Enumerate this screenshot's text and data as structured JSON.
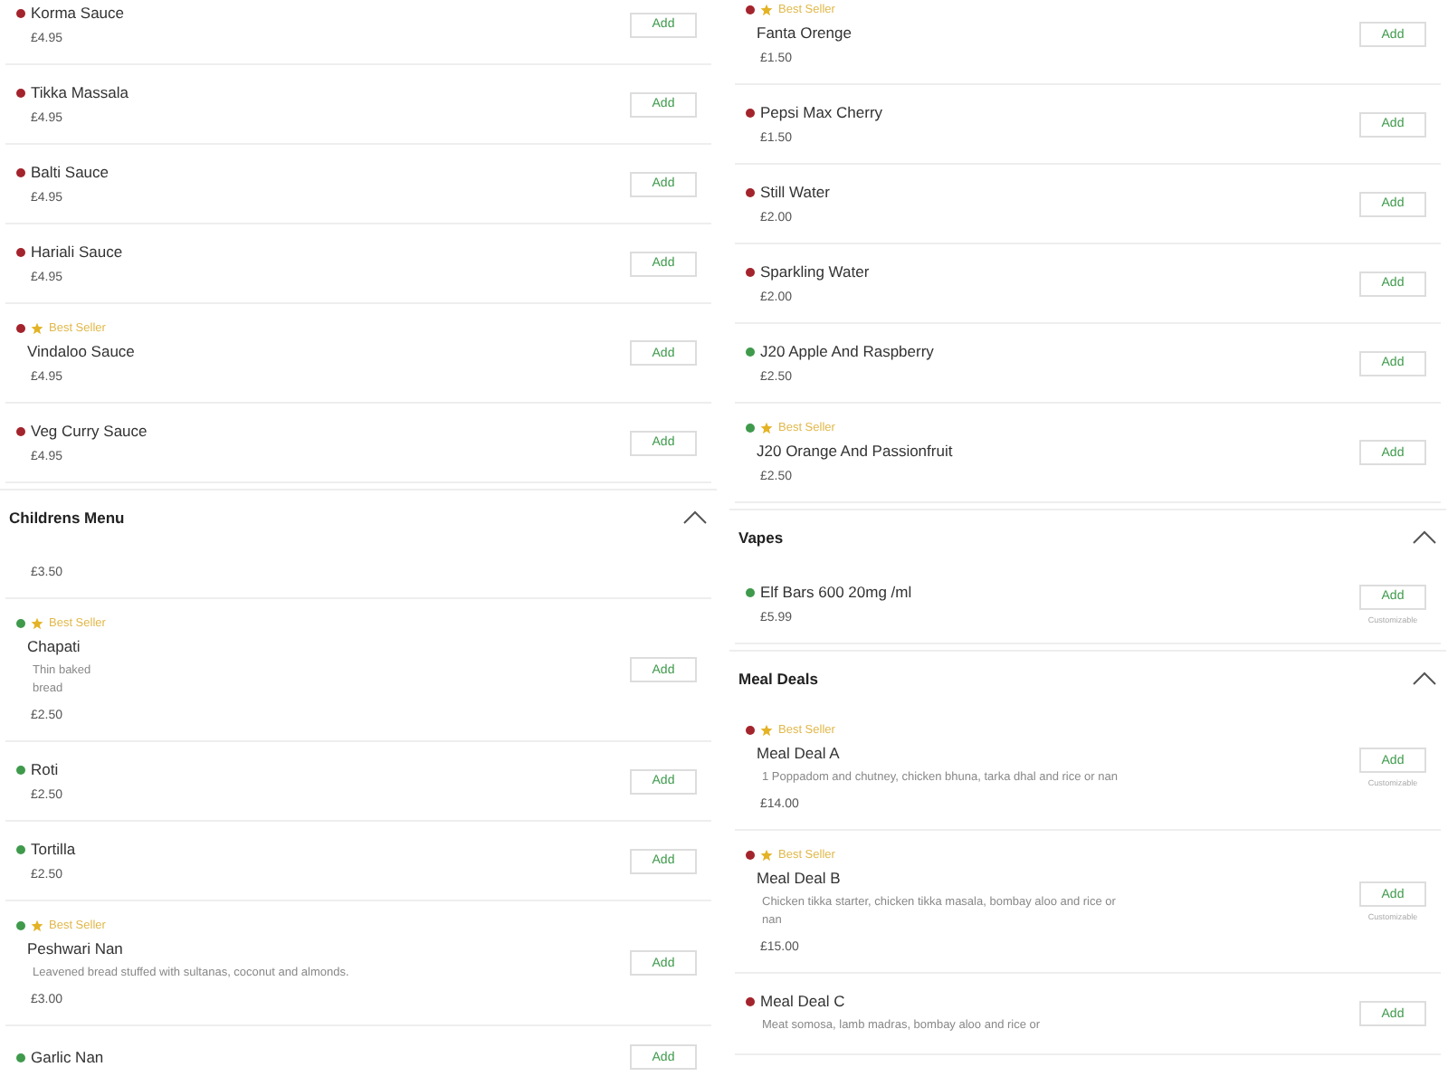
{
  "columns": [
    {
      "blocks": [
        {
          "kind": "item",
          "name": "Korma Sauce",
          "price": "£4.95",
          "color": "#a3242c",
          "button": "Add"
        },
        {
          "kind": "item",
          "name": "Tikka Massala",
          "price": "£4.95",
          "color": "#a3242c",
          "button": "Add"
        },
        {
          "kind": "item",
          "name": "Balti Sauce",
          "price": "£4.95",
          "color": "#a3242c",
          "button": "Add"
        },
        {
          "kind": "item",
          "name": "Hariali Sauce",
          "price": "£4.95",
          "color": "#a3242c",
          "button": "Add"
        },
        {
          "kind": "item",
          "badge": "Best Seller",
          "name": "Vindaloo Sauce",
          "price": "£4.95",
          "color": "#a3242c",
          "button": "Add"
        },
        {
          "kind": "item",
          "name": "Veg Curry Sauce",
          "price": "£4.95",
          "color": "#a3242c",
          "button": "Add"
        },
        {
          "kind": "section",
          "title": "Childrens Menu",
          "expanded": true
        },
        {
          "kind": "item",
          "price": "£3.50"
        },
        {
          "kind": "item",
          "badge": "Best Seller",
          "name": "Chapati",
          "description": "Thin baked bread",
          "narrow": true,
          "price": "£2.50",
          "color": "#3f9a4c",
          "button": "Add"
        },
        {
          "kind": "item",
          "name": "Roti",
          "price": "£2.50",
          "color": "#3f9a4c",
          "button": "Add"
        },
        {
          "kind": "item",
          "name": "Tortilla",
          "price": "£2.50",
          "color": "#3f9a4c",
          "button": "Add"
        },
        {
          "kind": "item",
          "badge": "Best Seller",
          "name": "Peshwari Nan",
          "description": "Leavened bread stuffed with sultanas, coconut and almonds.",
          "price": "£3.00",
          "color": "#3f9a4c",
          "button": "Add"
        },
        {
          "kind": "item",
          "name": "Garlic Nan",
          "color": "#3f9a4c",
          "button": "Add"
        }
      ]
    },
    {
      "blocks": [
        {
          "kind": "item",
          "badge": "Best Seller",
          "name": "Fanta Orenge",
          "price": "£1.50",
          "color": "#a3242c",
          "button": "Add"
        },
        {
          "kind": "item",
          "name": "Pepsi Max Cherry",
          "price": "£1.50",
          "color": "#a3242c",
          "button": "Add"
        },
        {
          "kind": "item",
          "name": "Still Water",
          "price": "£2.00",
          "color": "#a3242c",
          "button": "Add"
        },
        {
          "kind": "item",
          "name": "Sparkling Water",
          "price": "£2.00",
          "color": "#a3242c",
          "button": "Add"
        },
        {
          "kind": "item",
          "name": "J20 Apple And Raspberry",
          "price": "£2.50",
          "color": "#3f9a4c",
          "button": "Add"
        },
        {
          "kind": "item",
          "badge": "Best Seller",
          "name": "J20 Orange And Passionfruit",
          "price": "£2.50",
          "color": "#3f9a4c",
          "button": "Add"
        },
        {
          "kind": "section",
          "title": "Vapes",
          "expanded": true
        },
        {
          "kind": "item",
          "name": "Elf Bars 600 20mg /ml",
          "price": "£5.99",
          "color": "#3f9a4c",
          "button": "Add",
          "note": "Customizable"
        },
        {
          "kind": "section",
          "title": "Meal Deals",
          "expanded": true
        },
        {
          "kind": "item",
          "badge": "Best Seller",
          "name": "Meal Deal A",
          "description": "1 Poppadom and chutney, chicken bhuna, tarka dhal and rice or nan",
          "price": "£14.00",
          "color": "#a3242c",
          "button": "Add",
          "note": "Customizable"
        },
        {
          "kind": "item",
          "badge": "Best Seller",
          "name": "Meal Deal B",
          "description": "Chicken tikka starter, chicken tikka masala, bombay aloo and rice or nan",
          "price": "£15.00",
          "color": "#a3242c",
          "button": "Add",
          "note": "Customizable"
        },
        {
          "kind": "item",
          "name": "Meal Deal C",
          "description": "Meat somosa, lamb madras, bombay aloo and rice or",
          "color": "#a3242c",
          "button": "Add"
        }
      ]
    }
  ]
}
